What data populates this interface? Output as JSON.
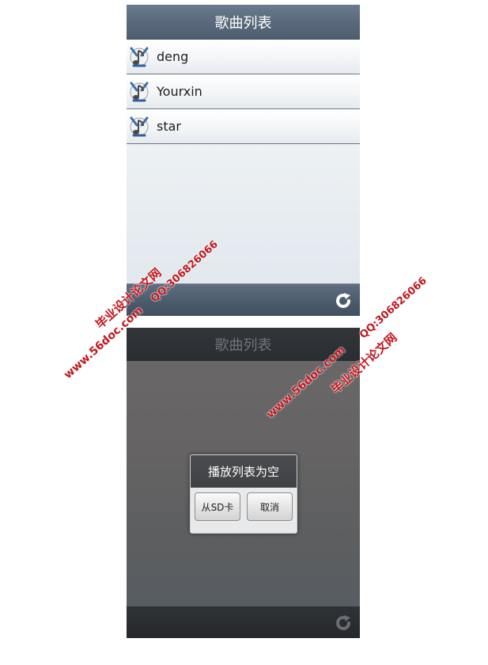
{
  "screen1": {
    "title": "歌曲列表",
    "songs": [
      {
        "label": "deng"
      },
      {
        "label": "Yourxin"
      },
      {
        "label": "star"
      }
    ],
    "refresh_icon": "refresh-icon",
    "song_icon": "music-note-icon"
  },
  "screen2": {
    "title": "歌曲列表",
    "dialog": {
      "title": "播放列表为空",
      "sd_button": "从SD卡",
      "cancel_button": "取消"
    },
    "refresh_icon": "refresh-icon"
  },
  "watermarks": {
    "wm1_name": "毕业设计论文网",
    "wm1_url": "www.56doc.com",
    "wm1_qq": "QQ:306826066",
    "wm2_name": "毕业设计论文网",
    "wm2_url": "www.56doc.com",
    "wm2_qq": "QQ:306826066"
  },
  "colors": {
    "watermark": "#c0171c",
    "titlebar": "#5a6a7c",
    "dialog_bg": "#e7e9ea"
  }
}
